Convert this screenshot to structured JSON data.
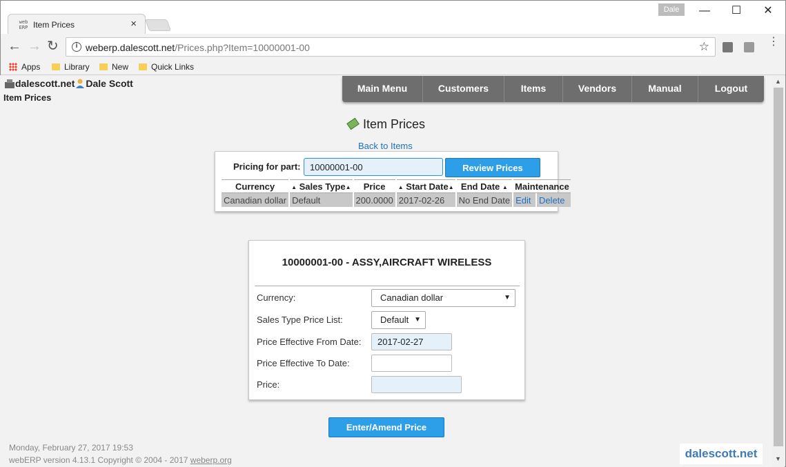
{
  "browser": {
    "tab_title": "Item Prices",
    "tab_close": "×",
    "favicon_text": "web ERP",
    "profile_name": "Dale",
    "window_controls": {
      "minimize": "—",
      "maximize": "☐",
      "close": "✕"
    },
    "url_host": "weberp.dalescott.net",
    "url_path": "/Prices.php?Item=10000001-00",
    "bookmarks": [
      {
        "label": "Apps",
        "icon": "apps-grid-icon"
      },
      {
        "label": "Library",
        "icon": "folder-icon"
      },
      {
        "label": "New",
        "icon": "folder-icon"
      },
      {
        "label": "Quick Links",
        "icon": "folder-icon"
      }
    ]
  },
  "header": {
    "company": "dalescott.net",
    "user": "Dale Scott",
    "page_subtitle": "Item Prices"
  },
  "nav": [
    {
      "label": "Main Menu"
    },
    {
      "label": "Customers"
    },
    {
      "label": "Items"
    },
    {
      "label": "Vendors"
    },
    {
      "label": "Manual"
    },
    {
      "label": "Logout"
    }
  ],
  "main": {
    "heading": "Item Prices",
    "back_link": "Back to Items",
    "pricing_label": "Pricing for part:",
    "part_value": "10000001-00",
    "review_button": "Review Prices",
    "table": {
      "headers": [
        "Currency",
        "Sales Type",
        "Price",
        "Start Date",
        "End Date",
        "Maintenance"
      ],
      "rows": [
        {
          "currency": "Canadian dollar",
          "sales_type": "Default",
          "price": "200.0000",
          "start_date": "2017-02-26",
          "end_date": "No End Date",
          "edit": "Edit",
          "delete": "Delete"
        }
      ]
    }
  },
  "form": {
    "title": "10000001-00 - ASSY,AIRCRAFT WIRELESS",
    "currency_label": "Currency:",
    "currency_value": "Canadian dollar",
    "sales_type_label": "Sales Type Price List:",
    "sales_type_value": "Default",
    "from_date_label": "Price Effective From Date:",
    "from_date_value": "2017-02-27",
    "to_date_label": "Price Effective To Date:",
    "to_date_value": "",
    "price_label": "Price:",
    "price_value": "",
    "submit_button": "Enter/Amend Price"
  },
  "footer": {
    "datetime": "Monday, February 27, 2017 19:53",
    "version_text": "webERP version 4.13.1 Copyright © 2004 - 2017 ",
    "version_link": "weberp.org",
    "watermark": "dalescott.net"
  },
  "colors": {
    "accent_button": "#2d9fe8",
    "nav_background": "#6e6e6e",
    "link": "#1e70bf",
    "table_cell": "#c8c8c8"
  }
}
